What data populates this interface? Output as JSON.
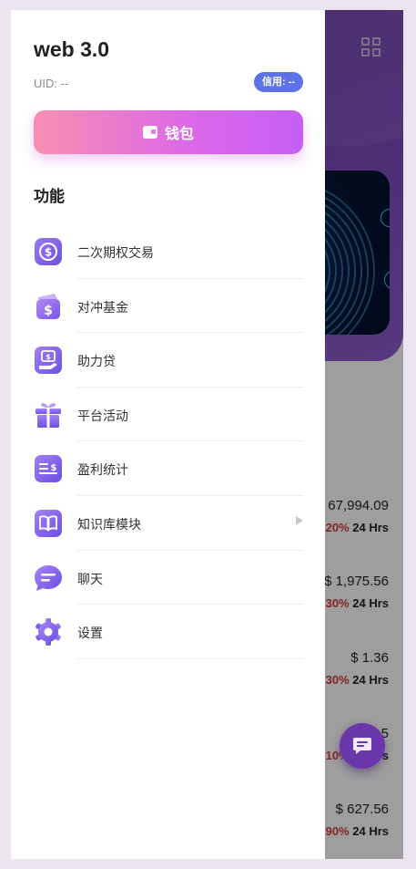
{
  "drawer": {
    "app_title": "web 3.0",
    "uid_text": "UID: --",
    "credit_badge": "信用: --",
    "wallet_button": "钱包",
    "section_title": "功能",
    "menu": [
      {
        "label": "二次期权交易",
        "icon": "exchange-coin-icon"
      },
      {
        "label": "对冲基金",
        "icon": "wallet-dollar-icon"
      },
      {
        "label": "助力贷",
        "icon": "loan-hand-icon"
      },
      {
        "label": "平台活动",
        "icon": "gift-icon"
      },
      {
        "label": "盈利统计",
        "icon": "profit-stats-icon"
      },
      {
        "label": "知识库模块",
        "icon": "book-icon",
        "has_arrow": true
      },
      {
        "label": "聊天",
        "icon": "chat-bubble-icon"
      },
      {
        "label": "设置",
        "icon": "gear-icon"
      }
    ]
  },
  "market_rows": [
    {
      "price": "67,994.09",
      "pct": "20%",
      "period": "24 Hrs"
    },
    {
      "price": "$ 1,975.56",
      "pct": "30%",
      "period": "24 Hrs"
    },
    {
      "price": "$ 1.36",
      "pct": "30%",
      "period": "24 Hrs"
    },
    {
      "price": "5",
      "pct": "10%",
      "period": "24 Hrs"
    },
    {
      "price": "$ 627.56",
      "pct": "90%",
      "period": "24 Hrs"
    }
  ],
  "colors": {
    "accent_purple": "#7c5ce6",
    "credit_badge": "#5b73e6",
    "wallet_gradient_start": "#f78fb0",
    "wallet_gradient_end": "#c65ef5",
    "header_purple": "#6a3aa5",
    "negative_red": "#d23b3b"
  }
}
